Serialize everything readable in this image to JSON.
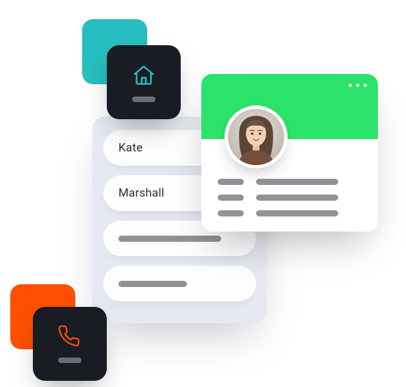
{
  "form": {
    "first_name": "Kate",
    "last_name": "Marshall"
  },
  "tiles": {
    "home_icon": "home-icon",
    "phone_icon": "phone-icon"
  },
  "colors": {
    "teal": "#28BDBE",
    "orange": "#FE5000",
    "green": "#2BE36B",
    "dark": "#1A1C23"
  }
}
